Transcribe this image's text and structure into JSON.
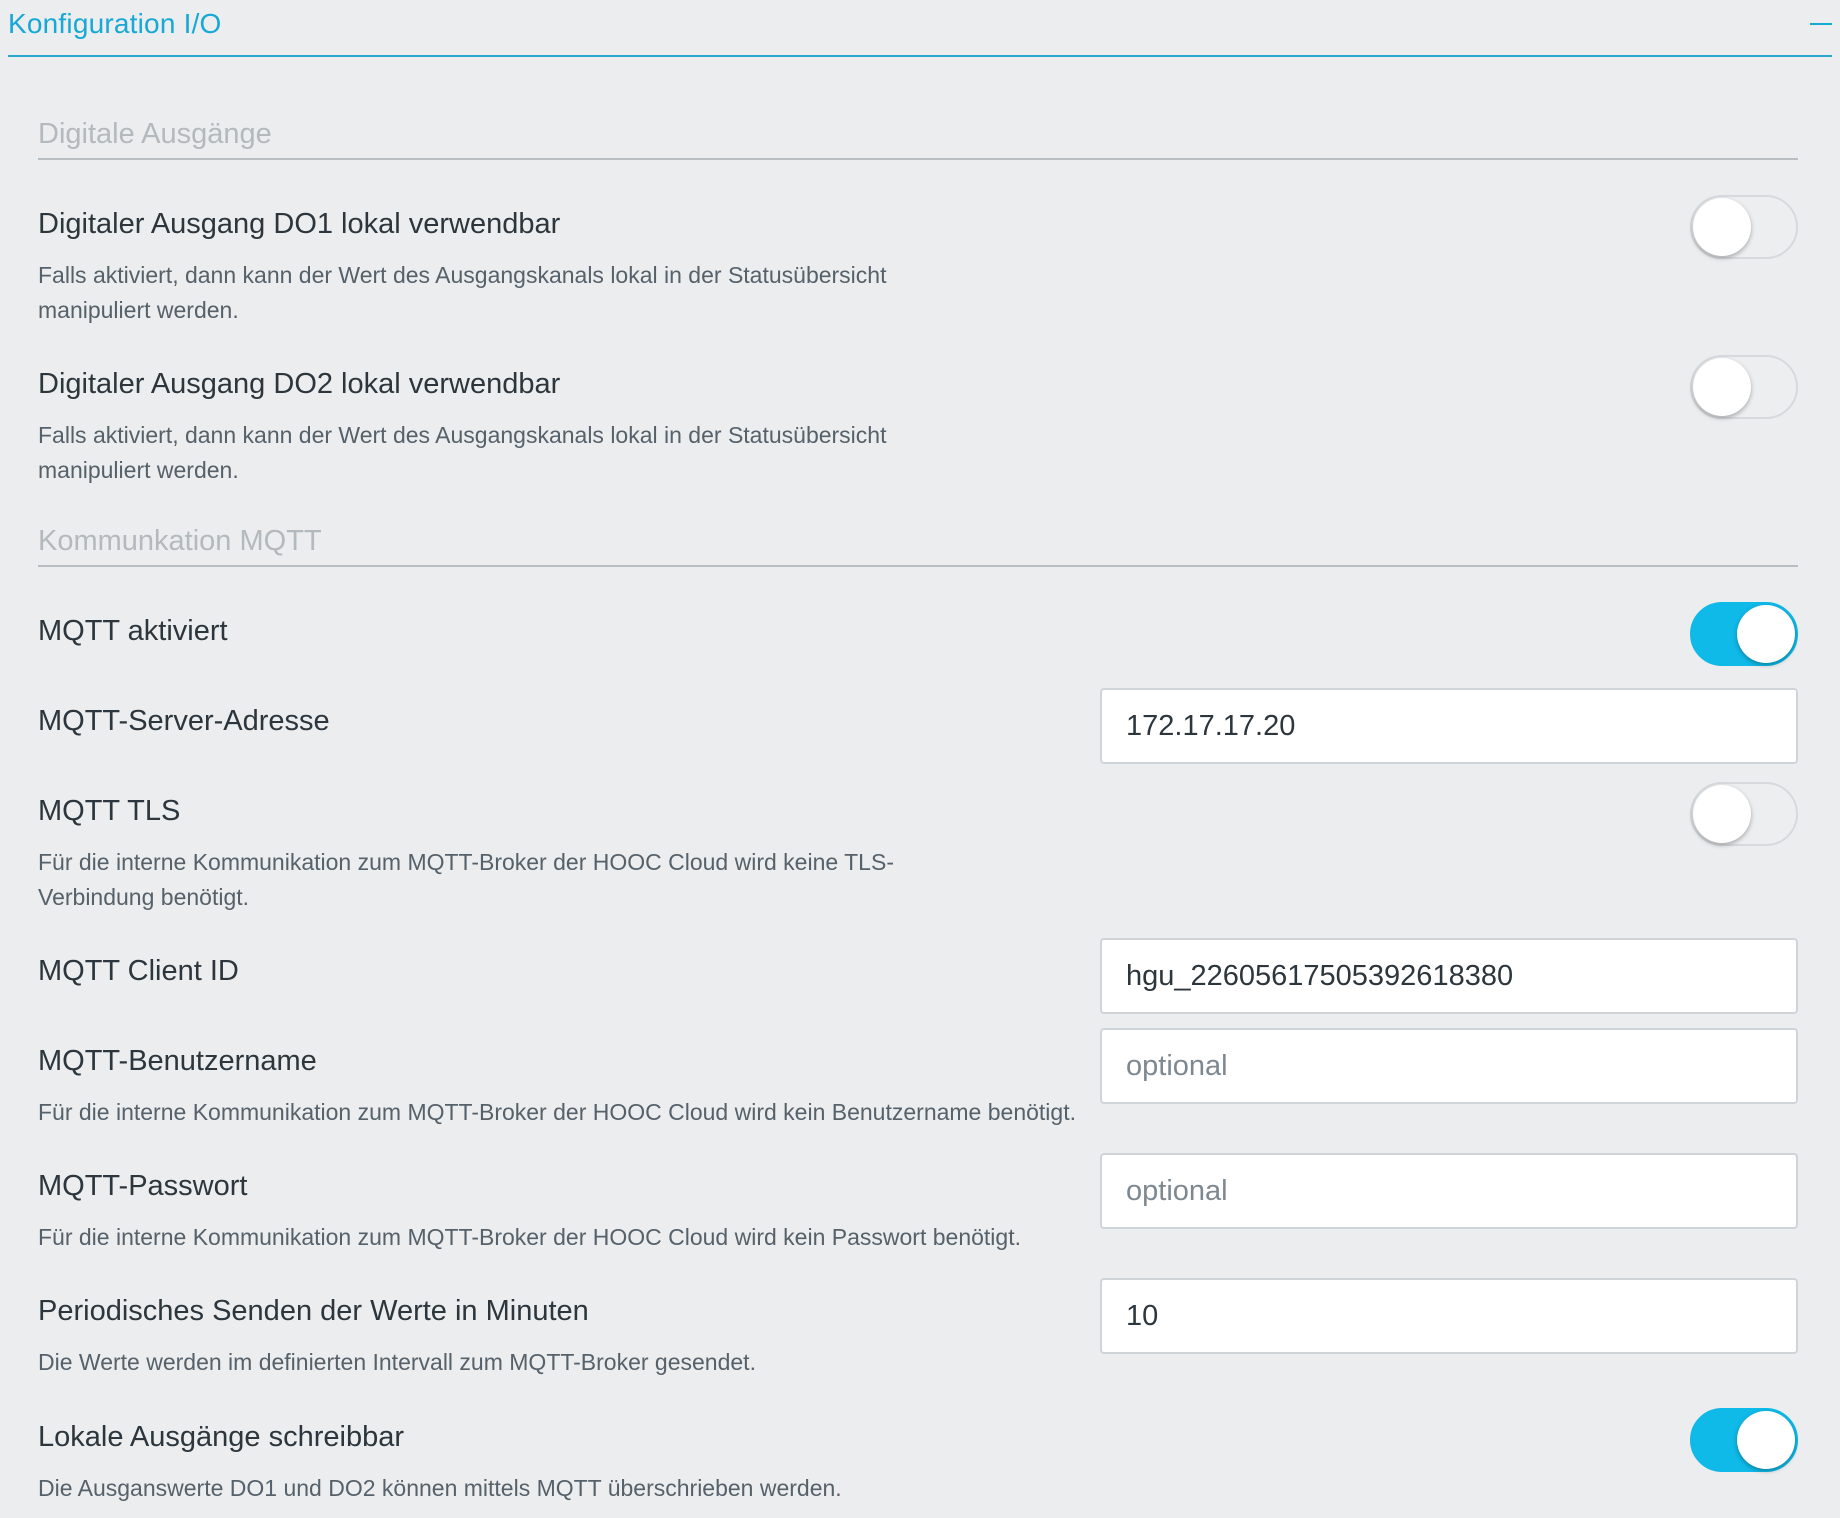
{
  "panel": {
    "title": "Konfiguration I/O",
    "collapse_icon": "minus-icon"
  },
  "colors": {
    "accent": "#17a9d6",
    "toggle_on": "#0fb9e8",
    "background": "#ebedef"
  },
  "sections": {
    "digital_outputs": {
      "title": "Digitale Ausgänge",
      "do1": {
        "label": "Digitaler Ausgang DO1 lokal verwendbar",
        "description": "Falls aktiviert, dann kann der Wert des Ausgangskanals lokal in der Statusübersicht manipuliert werden.",
        "enabled": false
      },
      "do2": {
        "label": "Digitaler Ausgang DO2 lokal verwendbar",
        "description": "Falls aktiviert, dann kann der Wert des Ausgangskanals lokal in der Statusübersicht manipuliert werden.",
        "enabled": false
      }
    },
    "mqtt": {
      "title": "Kommunkation MQTT",
      "enabled": {
        "label": "MQTT aktiviert",
        "value": true
      },
      "server": {
        "label": "MQTT-Server-Adresse",
        "value": "172.17.17.20"
      },
      "tls": {
        "label": "MQTT TLS",
        "description": "Für die interne Kommunikation zum MQTT-Broker der HOOC Cloud wird keine TLS-Verbindung benötigt.",
        "value": false
      },
      "client_id": {
        "label": "MQTT Client ID",
        "value": "hgu_22605617505392618380"
      },
      "username": {
        "label": "MQTT-Benutzername",
        "description": "Für die interne Kommunikation zum MQTT-Broker der HOOC Cloud wird kein Benutzername benötigt.",
        "value": "",
        "placeholder": "optional"
      },
      "password": {
        "label": "MQTT-Passwort",
        "description": "Für die interne Kommunikation zum MQTT-Broker der HOOC Cloud wird kein Passwort benötigt.",
        "value": "",
        "placeholder": "optional"
      },
      "interval": {
        "label": "Periodisches Senden der Werte in Minuten",
        "description": "Die Werte werden im definierten Intervall zum MQTT-Broker gesendet.",
        "value": "10"
      },
      "writable_outputs": {
        "label": "Lokale Ausgänge schreibbar",
        "description": "Die Ausganswerte DO1 und DO2 können mittels MQTT überschrieben werden.",
        "value": true
      }
    }
  }
}
